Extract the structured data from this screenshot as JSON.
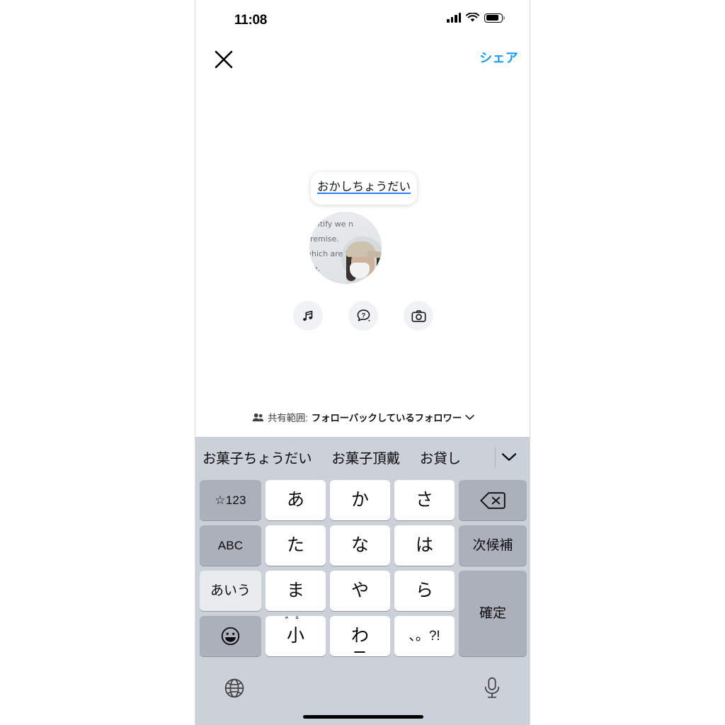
{
  "status_bar": {
    "time": "11:08",
    "signal_icon": "cellular-signal-icon",
    "wifi_icon": "wifi-icon",
    "battery_icon": "battery-icon"
  },
  "nav": {
    "close_icon": "close-icon",
    "share_label": "シェア"
  },
  "composer": {
    "text_bubble": "おかしちょうだい",
    "text_bubble_underline_color": "#2d7ff9",
    "avatar_overlay_lines": [
      "dentify we n",
      "premise.",
      "",
      "which are inspi",
      "ate."
    ],
    "tools": [
      {
        "name": "music-icon",
        "label": "ミュージック"
      },
      {
        "name": "question-sticker-icon",
        "label": "質問"
      },
      {
        "name": "camera-icon",
        "label": "カメラ"
      }
    ],
    "audience": {
      "people_icon": "people-icon",
      "label": "共有範囲:",
      "value": "フォローバックしているフォロワー",
      "chevron_icon": "chevron-down-icon"
    }
  },
  "keyboard": {
    "suggestions": [
      "お菓子ちょうだい",
      "お菓子頂戴",
      "お貸し"
    ],
    "expand_icon": "chevron-down-icon",
    "keys": {
      "r1": [
        {
          "id": "num-key",
          "label": "☆123",
          "style": "dark",
          "size": "tiny"
        },
        {
          "id": "a-key",
          "label": "あ",
          "style": "white",
          "size": "normal"
        },
        {
          "id": "ka-key",
          "label": "か",
          "style": "white",
          "size": "normal"
        },
        {
          "id": "sa-key",
          "label": "さ",
          "style": "white",
          "size": "normal"
        },
        {
          "id": "delete-key",
          "label": "",
          "style": "dark",
          "size": "icon"
        }
      ],
      "r2": [
        {
          "id": "abc-key",
          "label": "ABC",
          "style": "dark",
          "size": "tiny"
        },
        {
          "id": "ta-key",
          "label": "た",
          "style": "white",
          "size": "normal"
        },
        {
          "id": "na-key",
          "label": "な",
          "style": "white",
          "size": "normal"
        },
        {
          "id": "ha-key",
          "label": "は",
          "style": "white",
          "size": "normal"
        },
        {
          "id": "next-candidate-key",
          "label": "次候補",
          "style": "dark",
          "size": "small"
        }
      ],
      "r3": [
        {
          "id": "aiu-key",
          "label": "あいう",
          "style": "light",
          "size": "small"
        },
        {
          "id": "ma-key",
          "label": "ま",
          "style": "white",
          "size": "normal"
        },
        {
          "id": "ya-key",
          "label": "や",
          "style": "white",
          "size": "normal"
        },
        {
          "id": "ra-key",
          "label": "ら",
          "style": "white",
          "size": "normal"
        }
      ],
      "r4": [
        {
          "id": "emoji-key",
          "label": "",
          "style": "dark",
          "size": "icon"
        },
        {
          "id": "komoji-key",
          "label": "小",
          "marks": "゛゜",
          "style": "white",
          "size": "normal"
        },
        {
          "id": "wa-key",
          "label": "わ",
          "style": "white",
          "size": "normal"
        },
        {
          "id": "punct-key",
          "label": "、。?!",
          "style": "white",
          "size": "small"
        }
      ],
      "confirm": {
        "id": "confirm-key",
        "label": "確定",
        "style": "dark",
        "size": "small"
      }
    },
    "bottom": {
      "globe_icon": "globe-icon",
      "mic_icon": "microphone-icon"
    }
  },
  "colors": {
    "accent_blue": "#1d9bf0",
    "keyboard_bg": "#ccd0d8",
    "key_dark": "#abb0ba",
    "key_white": "#ffffff",
    "key_light": "#e9ebef"
  }
}
